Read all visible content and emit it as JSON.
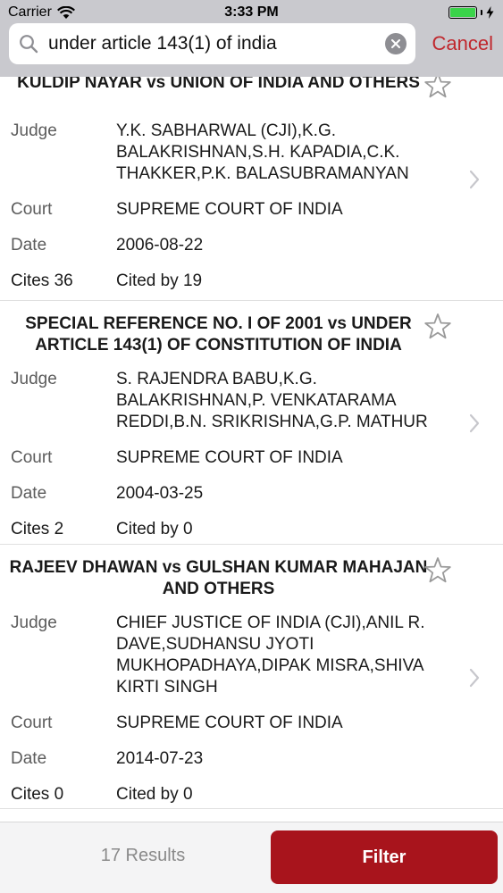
{
  "status_bar": {
    "carrier": "Carrier",
    "time": "3:33 PM",
    "battery_level": 1.0,
    "battery_color": "#3ad34a"
  },
  "search": {
    "value": "under article 143(1) of india",
    "cancel_label": "Cancel"
  },
  "results": [
    {
      "title": "KULDIP NAYAR vs UNION OF INDIA AND OTHERS",
      "judge_label": "Judge",
      "judge": "Y.K. SABHARWAL (CJI),K.G. BALAKRISHNAN,S.H. KAPADIA,C.K. THAKKER,P.K. BALASUBRAMANYAN",
      "court_label": "Court",
      "court": "SUPREME COURT OF INDIA",
      "date_label": "Date",
      "date": "2006-08-22",
      "cites": "Cites 36",
      "cited_by": "Cited by 19"
    },
    {
      "title": "SPECIAL REFERENCE NO. I OF 2001 vs UNDER ARTICLE 143(1) OF CONSTITUTION OF INDIA",
      "judge_label": "Judge",
      "judge": "S. RAJENDRA BABU,K.G. BALAKRISHNAN,P. VENKATARAMA REDDI,B.N. SRIKRISHNA,G.P. MATHUR",
      "court_label": "Court",
      "court": "SUPREME COURT OF INDIA",
      "date_label": "Date",
      "date": "2004-03-25",
      "cites": "Cites 2",
      "cited_by": "Cited by 0"
    },
    {
      "title": "RAJEEV DHAWAN vs GULSHAN KUMAR MAHAJAN AND OTHERS",
      "judge_label": "Judge",
      "judge": "CHIEF JUSTICE OF INDIA (CJI),ANIL R. DAVE,SUDHANSU JYOTI MUKHOPADHAYA,DIPAK MISRA,SHIVA KIRTI SINGH",
      "court_label": "Court",
      "court": "SUPREME COURT OF INDIA",
      "date_label": "Date",
      "date": "2014-07-23",
      "cites": "Cites 0",
      "cited_by": "Cited by 0"
    }
  ],
  "bottom_bar": {
    "results_count": "17 Results",
    "filter_label": "Filter"
  },
  "colors": {
    "accent": "#c0272d",
    "filter_button": "#a8141c",
    "search_bar_bg": "#c9c9ce"
  },
  "icons": {
    "search": "search-icon",
    "clear": "clear-icon",
    "star": "star-outline-icon",
    "chevron": "chevron-right-icon",
    "wifi": "wifi-icon",
    "battery": "battery-icon",
    "charging": "charging-bolt-icon"
  }
}
